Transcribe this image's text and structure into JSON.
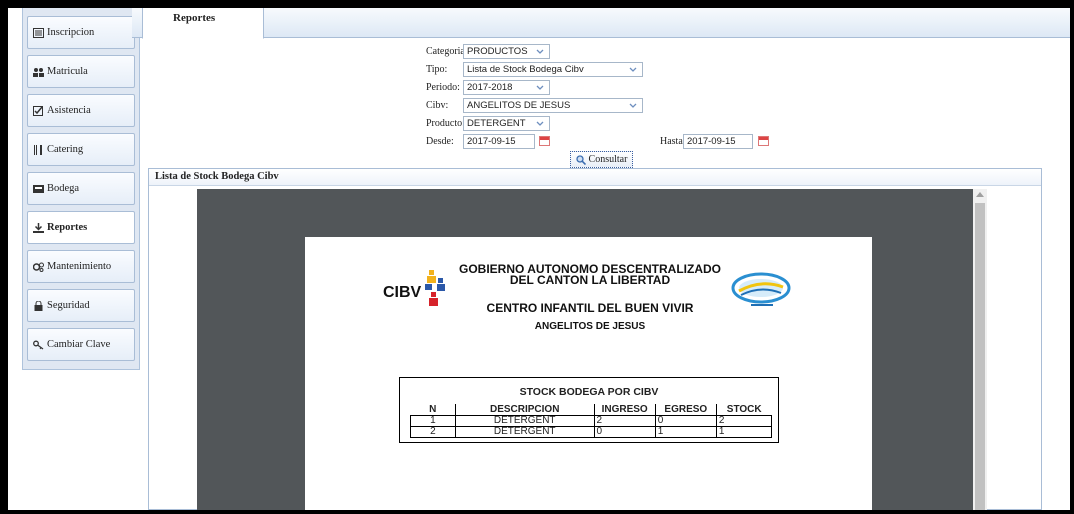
{
  "sidebar": {
    "items": [
      {
        "label": "Inscripcion",
        "icon": "list-icon",
        "active": false
      },
      {
        "label": "Matricula",
        "icon": "users-icon",
        "active": false
      },
      {
        "label": "Asistencia",
        "icon": "check-square-icon",
        "active": false
      },
      {
        "label": "Catering",
        "icon": "cutlery-icon",
        "active": false
      },
      {
        "label": "Bodega",
        "icon": "inbox-icon",
        "active": false
      },
      {
        "label": "Reportes",
        "icon": "download-icon",
        "active": true
      },
      {
        "label": "Mantenimiento",
        "icon": "gears-icon",
        "active": false
      },
      {
        "label": "Seguridad",
        "icon": "lock-icon",
        "active": false
      },
      {
        "label": "Cambiar Clave",
        "icon": "key-icon",
        "active": false
      }
    ]
  },
  "tabs": {
    "active": "Reportes"
  },
  "form": {
    "categoria_label": "Categoria:",
    "categoria_value": "PRODUCTOS",
    "tipo_label": "Tipo:",
    "tipo_value": "Lista de Stock Bodega Cibv",
    "periodo_label": "Periodo:",
    "periodo_value": "2017-2018",
    "cibv_label": "Cibv:",
    "cibv_value": "ANGELITOS DE JESUS",
    "producto_label": "Producto:",
    "producto_value": "DETERGENT",
    "desde_label": "Desde:",
    "desde_value": "2017-09-15",
    "hasta_label": "Hasta:",
    "hasta_value": "2017-09-15",
    "consultar_label": "Consultar"
  },
  "panel": {
    "title": "Lista de Stock Bodega Cibv"
  },
  "report": {
    "org_line1": "GOBIERNO AUTONOMO DESCENTRALIZADO",
    "org_line2": "DEL CANTON LA LIBERTAD",
    "center": "CENTRO INFANTIL DEL BUEN VIVIR",
    "cibv_name": "ANGELITOS DE JESUS",
    "logo_text": "CIBV",
    "table_title": "STOCK BODEGA POR CIBV",
    "columns": [
      "N",
      "DESCRIPCION",
      "INGRESO",
      "EGRESO",
      "STOCK"
    ],
    "rows": [
      [
        "1",
        "DETERGENT",
        "2",
        "0",
        "2"
      ],
      [
        "2",
        "DETERGENT",
        "0",
        "1",
        "1"
      ]
    ]
  },
  "colors": {
    "sidebar_bg": "#dfe7f2",
    "viewer_bg": "#525659",
    "accent_border": "#a9bdd6"
  }
}
